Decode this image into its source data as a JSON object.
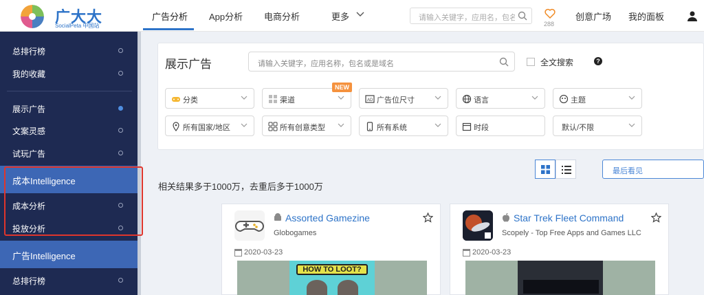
{
  "brand": {
    "name": "广大大",
    "subtitle": "SocialPeta 中国站"
  },
  "nav": {
    "items": [
      "广告分析",
      "App分析",
      "电商分析",
      "更多"
    ],
    "search_placeholder": "请输入关键字，应用名，包名或是域名",
    "favorites_count": "288",
    "creative_plaza": "创意广场",
    "my_panel": "我的面板"
  },
  "sidebar": {
    "items": [
      {
        "label": "总排行榜"
      },
      {
        "label": "我的收藏"
      },
      {
        "label": "展示广告"
      },
      {
        "label": "文案灵感"
      },
      {
        "label": "试玩广告"
      },
      {
        "label": "成本Intelligence"
      },
      {
        "label": "成本分析"
      },
      {
        "label": "投放分析"
      },
      {
        "label": "广告Intelligence"
      },
      {
        "label": "总排行榜"
      }
    ]
  },
  "panel": {
    "title": "展示广告",
    "search_placeholder": "请输入关键字，应用名称，包名或是域名",
    "fulltext_label": "全文搜索",
    "help": "?",
    "filters_row1": [
      {
        "label": "分类",
        "icon": "gamepad-icon"
      },
      {
        "label": "渠道",
        "icon": "grid-icon"
      },
      {
        "label": "广告位尺寸",
        "icon": "ad-size-icon"
      },
      {
        "label": "语言",
        "icon": "globe-icon"
      },
      {
        "label": "主题",
        "icon": "theme-icon"
      }
    ],
    "new_badge": "NEW",
    "filters_row2": [
      {
        "label": "所有国家/地区",
        "icon": "location-icon"
      },
      {
        "label": "所有创意类型",
        "icon": "creative-icon"
      },
      {
        "label": "所有系统",
        "icon": "phone-icon"
      },
      {
        "label": "时段",
        "icon": "calendar-icon"
      },
      {
        "label": "默认/不限",
        "icon": ""
      }
    ]
  },
  "results": {
    "summary": "相关结果多于1000万，去重后多于1000万",
    "sort": "最后看见"
  },
  "cards": [
    {
      "title": "Assorted Gamezine",
      "publisher": "Globogames",
      "platform": "android",
      "date": "2020-03-23"
    },
    {
      "title": "Star Trek Fleet Command",
      "publisher": "Scopely - Top Free Apps and Games LLC",
      "platform": "apple",
      "date": "2020-03-23"
    }
  ],
  "colors": {
    "accent": "#2d73c8",
    "sidebar": "#1e2a52",
    "sidebar_header": "#3d67b5",
    "highlight_box": "#e0352b",
    "new_badge": "#f5923e"
  }
}
